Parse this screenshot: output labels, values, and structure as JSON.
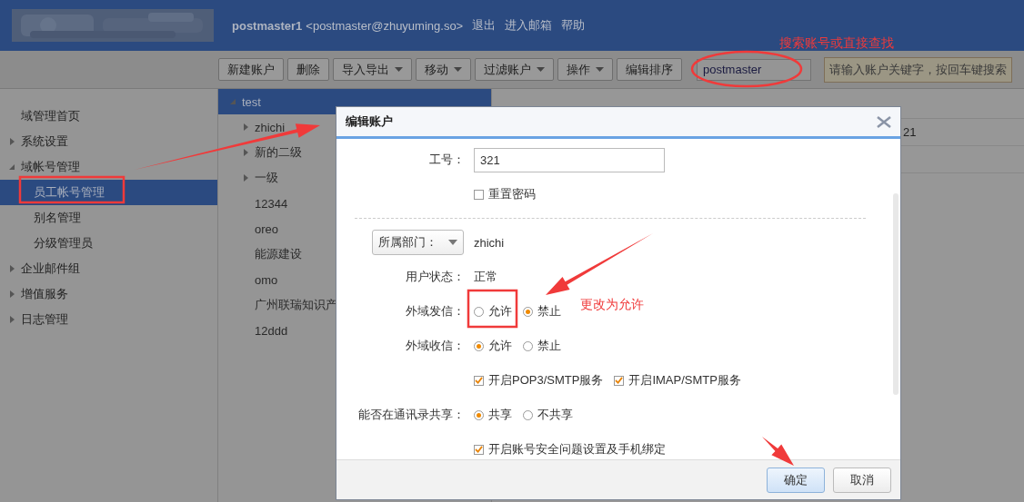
{
  "header": {
    "user": "postmaster1",
    "email": "<postmaster@zhuyuming.so>",
    "links": [
      "退出",
      "进入邮箱",
      "帮助"
    ]
  },
  "toolbar": {
    "buttons": [
      {
        "label": "新建账户",
        "dropdown": false
      },
      {
        "label": "删除",
        "dropdown": false
      },
      {
        "label": "导入导出",
        "dropdown": true
      },
      {
        "label": "移动",
        "dropdown": true
      },
      {
        "label": "过滤账户",
        "dropdown": true
      },
      {
        "label": "操作",
        "dropdown": true
      },
      {
        "label": "编辑排序",
        "dropdown": false
      }
    ],
    "search": {
      "value": "postmaster"
    },
    "tooltip": "请输入账户关键字，按回车键搜索"
  },
  "sidebar": {
    "items": [
      {
        "label": "域管理首页",
        "selected": false
      },
      {
        "label": "系统设置",
        "selected": false,
        "expanded": false
      },
      {
        "label": "域帐号管理",
        "selected": false,
        "expanded": true,
        "children": [
          {
            "label": "员工帐号管理",
            "selected": true
          },
          {
            "label": "别名管理",
            "selected": false
          },
          {
            "label": "分级管理员",
            "selected": false
          }
        ]
      },
      {
        "label": "企业邮件组",
        "selected": false,
        "expanded": false
      },
      {
        "label": "增值服务",
        "selected": false,
        "expanded": false
      },
      {
        "label": "日志管理",
        "selected": false,
        "expanded": false
      }
    ]
  },
  "departments": [
    {
      "label": "test",
      "selected": true,
      "expanded": true,
      "children": [
        {
          "label": "zhichi",
          "selected": false,
          "expanded": false
        },
        {
          "label": "新的二级",
          "selected": false,
          "expanded": false
        },
        {
          "label": "一级",
          "selected": false,
          "expanded": false
        },
        {
          "label": "12344",
          "selected": false
        },
        {
          "label": "oreo",
          "selected": false
        },
        {
          "label": "能源建设",
          "selected": false
        },
        {
          "label": "omo",
          "selected": false
        },
        {
          "label": "广州联瑞知识产",
          "selected": false
        },
        {
          "label": "12ddd",
          "selected": false
        }
      ]
    }
  ],
  "table": {
    "rows": [
      [
        "21"
      ],
      [
        ""
      ]
    ]
  },
  "dialog": {
    "title": "编辑账户",
    "fields": [
      {
        "kind": "input",
        "label": "工号：",
        "value": "321"
      },
      {
        "kind": "checks",
        "items": [
          {
            "label": "重置密码",
            "checked": false
          }
        ]
      },
      {
        "kind": "divider"
      },
      {
        "kind": "dropdown",
        "button": "所属部门：",
        "value": "zhichi"
      },
      {
        "kind": "static",
        "label": "用户状态：",
        "value": "正常"
      },
      {
        "kind": "radios",
        "label": "外域发信：",
        "options": [
          {
            "label": "允许",
            "selected": false
          },
          {
            "label": "禁止",
            "selected": true
          }
        ]
      },
      {
        "kind": "radios",
        "label": "外域收信：",
        "options": [
          {
            "label": "允许",
            "selected": true
          },
          {
            "label": "禁止",
            "selected": false
          }
        ]
      },
      {
        "kind": "checks",
        "items": [
          {
            "label": "开启POP3/SMTP服务",
            "checked": true
          },
          {
            "label": "开启IMAP/SMTP服务",
            "checked": true
          }
        ]
      },
      {
        "kind": "radios",
        "label": "能否在通讯录共享：",
        "options": [
          {
            "label": "共享",
            "selected": true
          },
          {
            "label": "不共享",
            "selected": false
          }
        ]
      },
      {
        "kind": "checks",
        "items": [
          {
            "label": "开启账号安全问题设置及手机绑定",
            "checked": true
          }
        ]
      }
    ],
    "buttons": [
      {
        "label": "确定",
        "primary": true
      },
      {
        "label": "取消",
        "primary": false
      }
    ]
  },
  "annotations": {
    "search_hint": "搜索账号或直接查找",
    "change_hint": "更改为允许"
  }
}
